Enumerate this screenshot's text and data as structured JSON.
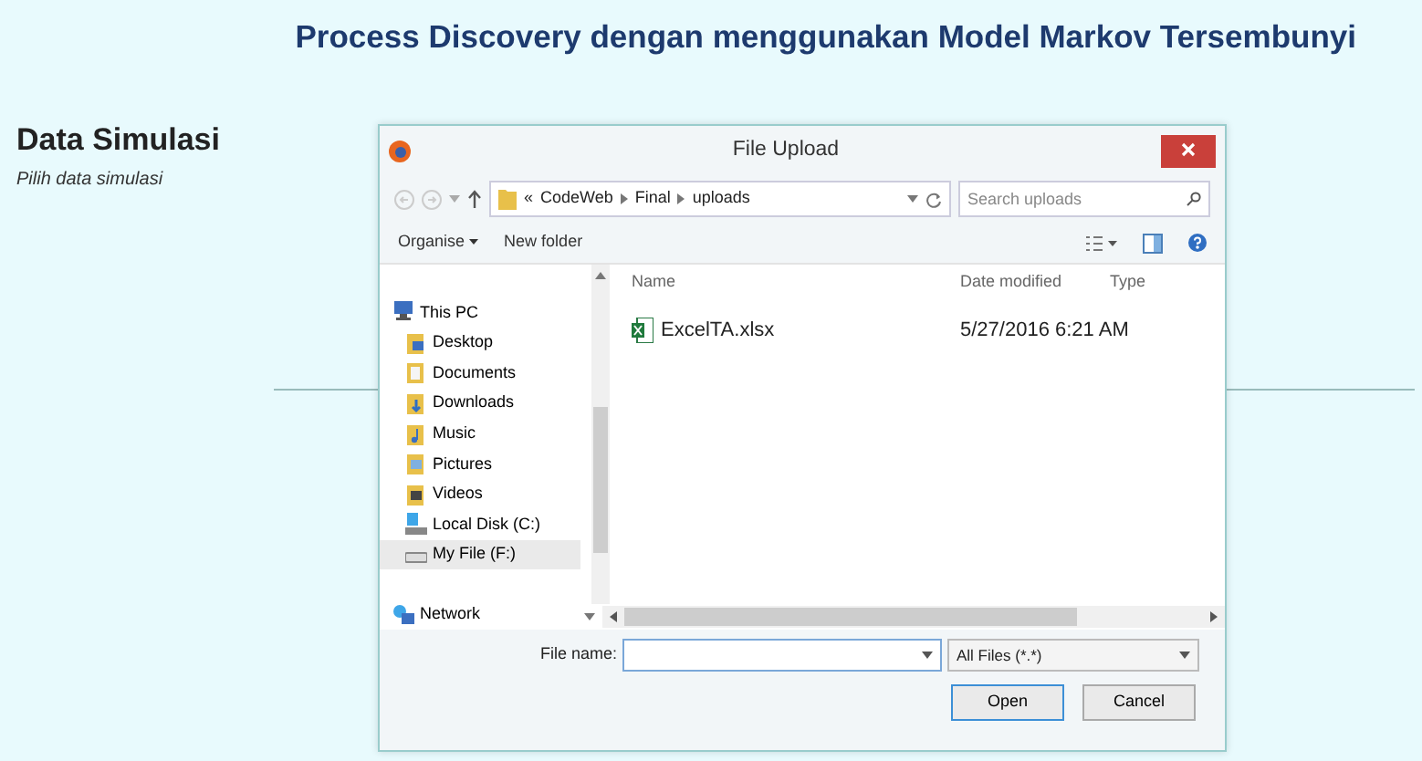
{
  "page": {
    "title": "Process Discovery dengan menggunakan Model Markov Tersembunyi",
    "section_title": "Data Simulasi",
    "section_hint": "Pilih data simulasi"
  },
  "dialog": {
    "title": "File Upload",
    "address": {
      "prefix": "«",
      "parts": [
        "CodeWeb",
        "Final",
        "uploads"
      ]
    },
    "search": {
      "placeholder": "Search uploads"
    },
    "toolbar": [
      "Organise",
      "New folder"
    ],
    "nav": [
      {
        "label": "This PC",
        "kind": "pc",
        "selected": false,
        "children": [
          {
            "label": "Desktop",
            "kind": "desktop",
            "selected": false
          },
          {
            "label": "Documents",
            "kind": "documents",
            "selected": false
          },
          {
            "label": "Downloads",
            "kind": "downloads",
            "selected": false
          },
          {
            "label": "Music",
            "kind": "music",
            "selected": false
          },
          {
            "label": "Pictures",
            "kind": "pictures",
            "selected": false
          },
          {
            "label": "Videos",
            "kind": "videos",
            "selected": false
          },
          {
            "label": "Local Disk (C:)",
            "kind": "disk",
            "selected": false
          },
          {
            "label": "My File (F:)",
            "kind": "drive",
            "selected": true
          }
        ]
      },
      {
        "label": "Network",
        "kind": "network",
        "selected": false
      }
    ],
    "columns": [
      "Name",
      "Date modified",
      "Type"
    ],
    "files": [
      {
        "name": "ExcelTA.xlsx",
        "date": "5/27/2016 6:21 AM"
      }
    ],
    "file_name": {
      "label": "File name:"
    },
    "filter": "All Files (*.*)",
    "buttons": [
      {
        "label": "Open",
        "default": true
      },
      {
        "label": "Cancel",
        "default": false
      }
    ]
  }
}
